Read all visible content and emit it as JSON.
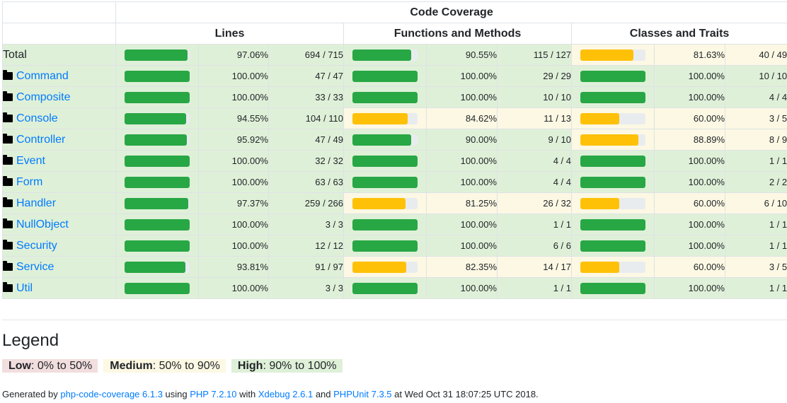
{
  "header": {
    "title": "Code Coverage",
    "columns": [
      "Lines",
      "Functions and Methods",
      "Classes and Traits"
    ]
  },
  "colors": {
    "high_bar": "#28a745",
    "medium_bar": "#ffc107",
    "high_bg": "#dff0d8",
    "medium_bg": "#fcf8e3",
    "low_bg": "#f2dede",
    "link": "#007bff"
  },
  "rows": [
    {
      "name": "Total",
      "link": false,
      "lines": {
        "pct": "97.06%",
        "count": "694 / 715",
        "level": "high",
        "fraction": 0.9706
      },
      "functions": {
        "pct": "90.55%",
        "count": "115 / 127",
        "level": "high",
        "fraction": 0.9055
      },
      "classes": {
        "pct": "81.63%",
        "count": "40 / 49",
        "level": "medium",
        "fraction": 0.8163
      }
    },
    {
      "name": "Command",
      "link": true,
      "lines": {
        "pct": "100.00%",
        "count": "47 / 47",
        "level": "high",
        "fraction": 1.0
      },
      "functions": {
        "pct": "100.00%",
        "count": "29 / 29",
        "level": "high",
        "fraction": 1.0
      },
      "classes": {
        "pct": "100.00%",
        "count": "10 / 10",
        "level": "high",
        "fraction": 1.0
      }
    },
    {
      "name": "Composite",
      "link": true,
      "lines": {
        "pct": "100.00%",
        "count": "33 / 33",
        "level": "high",
        "fraction": 1.0
      },
      "functions": {
        "pct": "100.00%",
        "count": "10 / 10",
        "level": "high",
        "fraction": 1.0
      },
      "classes": {
        "pct": "100.00%",
        "count": "4 / 4",
        "level": "high",
        "fraction": 1.0
      }
    },
    {
      "name": "Console",
      "link": true,
      "lines": {
        "pct": "94.55%",
        "count": "104 / 110",
        "level": "high",
        "fraction": 0.9455
      },
      "functions": {
        "pct": "84.62%",
        "count": "11 / 13",
        "level": "medium",
        "fraction": 0.8462
      },
      "classes": {
        "pct": "60.00%",
        "count": "3 / 5",
        "level": "medium",
        "fraction": 0.6
      }
    },
    {
      "name": "Controller",
      "link": true,
      "lines": {
        "pct": "95.92%",
        "count": "47 / 49",
        "level": "high",
        "fraction": 0.9592
      },
      "functions": {
        "pct": "90.00%",
        "count": "9 / 10",
        "level": "high",
        "fraction": 0.9
      },
      "classes": {
        "pct": "88.89%",
        "count": "8 / 9",
        "level": "medium",
        "fraction": 0.8889
      }
    },
    {
      "name": "Event",
      "link": true,
      "lines": {
        "pct": "100.00%",
        "count": "32 / 32",
        "level": "high",
        "fraction": 1.0
      },
      "functions": {
        "pct": "100.00%",
        "count": "4 / 4",
        "level": "high",
        "fraction": 1.0
      },
      "classes": {
        "pct": "100.00%",
        "count": "1 / 1",
        "level": "high",
        "fraction": 1.0
      }
    },
    {
      "name": "Form",
      "link": true,
      "lines": {
        "pct": "100.00%",
        "count": "63 / 63",
        "level": "high",
        "fraction": 1.0
      },
      "functions": {
        "pct": "100.00%",
        "count": "4 / 4",
        "level": "high",
        "fraction": 1.0
      },
      "classes": {
        "pct": "100.00%",
        "count": "2 / 2",
        "level": "high",
        "fraction": 1.0
      }
    },
    {
      "name": "Handler",
      "link": true,
      "lines": {
        "pct": "97.37%",
        "count": "259 / 266",
        "level": "high",
        "fraction": 0.9737
      },
      "functions": {
        "pct": "81.25%",
        "count": "26 / 32",
        "level": "medium",
        "fraction": 0.8125
      },
      "classes": {
        "pct": "60.00%",
        "count": "6 / 10",
        "level": "medium",
        "fraction": 0.6
      }
    },
    {
      "name": "NullObject",
      "link": true,
      "lines": {
        "pct": "100.00%",
        "count": "3 / 3",
        "level": "high",
        "fraction": 1.0
      },
      "functions": {
        "pct": "100.00%",
        "count": "1 / 1",
        "level": "high",
        "fraction": 1.0
      },
      "classes": {
        "pct": "100.00%",
        "count": "1 / 1",
        "level": "high",
        "fraction": 1.0
      }
    },
    {
      "name": "Security",
      "link": true,
      "lines": {
        "pct": "100.00%",
        "count": "12 / 12",
        "level": "high",
        "fraction": 1.0
      },
      "functions": {
        "pct": "100.00%",
        "count": "6 / 6",
        "level": "high",
        "fraction": 1.0
      },
      "classes": {
        "pct": "100.00%",
        "count": "1 / 1",
        "level": "high",
        "fraction": 1.0
      }
    },
    {
      "name": "Service",
      "link": true,
      "lines": {
        "pct": "93.81%",
        "count": "91 / 97",
        "level": "high",
        "fraction": 0.9381
      },
      "functions": {
        "pct": "82.35%",
        "count": "14 / 17",
        "level": "medium",
        "fraction": 0.8235
      },
      "classes": {
        "pct": "60.00%",
        "count": "3 / 5",
        "level": "medium",
        "fraction": 0.6
      }
    },
    {
      "name": "Util",
      "link": true,
      "lines": {
        "pct": "100.00%",
        "count": "3 / 3",
        "level": "high",
        "fraction": 1.0
      },
      "functions": {
        "pct": "100.00%",
        "count": "1 / 1",
        "level": "high",
        "fraction": 1.0
      },
      "classes": {
        "pct": "100.00%",
        "count": "1 / 1",
        "level": "high",
        "fraction": 1.0
      }
    }
  ],
  "legend": {
    "title": "Legend",
    "low": {
      "label": "Low",
      "range": ": 0% to 50%"
    },
    "medium": {
      "label": "Medium",
      "range": ": 50% to 90%"
    },
    "high": {
      "label": "High",
      "range": ": 90% to 100%"
    }
  },
  "footer": {
    "t1": "Generated by ",
    "l1": "php-code-coverage 6.1.3",
    "t2": " using ",
    "l2": "PHP 7.2.10",
    "t3": " with ",
    "l3": "Xdebug 2.6.1",
    "t4": " and ",
    "l4": "PHPUnit 7.3.5",
    "t5": " at Wed Oct 31 18:07:25 UTC 2018."
  }
}
